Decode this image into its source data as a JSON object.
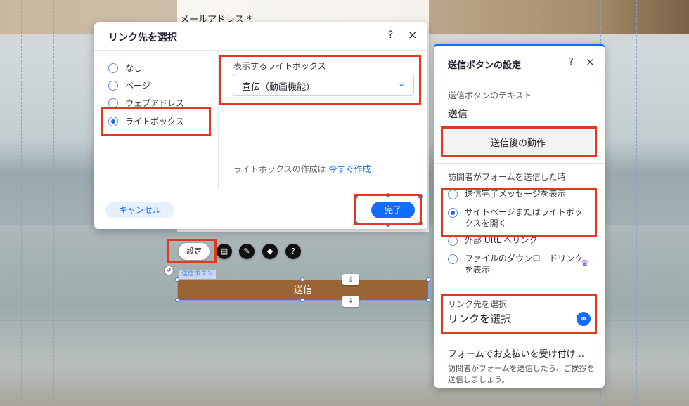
{
  "form": {
    "email_label": "メールアドレス *"
  },
  "link_dialog": {
    "title": "リンク先を選択",
    "help": "?",
    "close": "×",
    "options": [
      {
        "label": "なし",
        "selected": false
      },
      {
        "label": "ページ",
        "selected": false
      },
      {
        "label": "ウェブアドレス",
        "selected": false
      },
      {
        "label": "ライトボックス",
        "selected": true
      }
    ],
    "lightbox_label": "表示するライトボックス",
    "lightbox_value": "宣伝（動画機能）",
    "create_text": "ライトボックスの作成は",
    "create_link": "今すぐ作成",
    "cancel": "キャンセル",
    "done": "完了"
  },
  "toolbar": {
    "settings": "設定",
    "tag": "送信ボタン",
    "submit": "送信"
  },
  "settings_panel": {
    "title": "送信ボタンの設定",
    "help": "?",
    "close": "×",
    "text_label": "送信ボタンのテキスト",
    "text_value": "送信",
    "after_action": "送信後の動作",
    "when_label": "訪問者がフォームを送信した時",
    "options": [
      {
        "label": "送信完了メッセージを表示",
        "selected": false
      },
      {
        "label": "サイトページまたはライトボックスを開く",
        "selected": true
      },
      {
        "label": "外部 URL へリンク",
        "selected": false
      },
      {
        "label": "ファイルのダウンロードリンクを表示",
        "selected": false
      }
    ],
    "link_label": "リンク先を選択",
    "link_value": "リンクを選択",
    "pay_title": "フォームでお支払いを受け付け...",
    "pay_desc": "訪問者がフォームを送信したら、ご挨拶を送信しましょう。"
  },
  "colors": {
    "accent": "#116dff",
    "highlight": "#e03a1e",
    "submit_button": "#9b6434"
  }
}
